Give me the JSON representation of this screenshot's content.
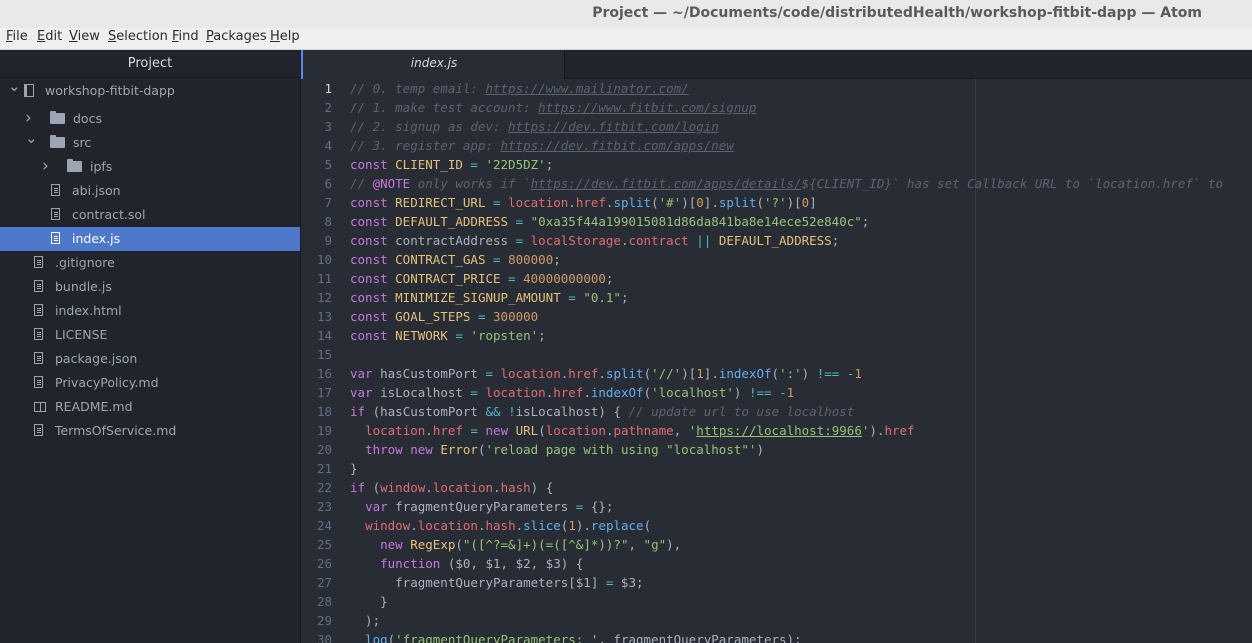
{
  "window": {
    "title": "Project — ~/Documents/code/distributedHealth/workshop-fitbit-dapp — Atom"
  },
  "menu": [
    {
      "label": "File",
      "u": "F",
      "rest": "ile"
    },
    {
      "label": "Edit",
      "u": "E",
      "rest": "dit"
    },
    {
      "label": "View",
      "u": "V",
      "rest": "iew"
    },
    {
      "label": "Selection",
      "u": "S",
      "rest": "election"
    },
    {
      "label": "Find",
      "u": "F",
      "rest": "ind"
    },
    {
      "label": "Packages",
      "u": "P",
      "rest": "ackages"
    },
    {
      "label": "Help",
      "u": "H",
      "rest": "elp"
    }
  ],
  "sidebar": {
    "header": "Project",
    "tree": [
      {
        "label": "workshop-fitbit-dapp",
        "kind": "repo",
        "depth": 0,
        "chevron": "down",
        "selected": false
      },
      {
        "label": "docs",
        "kind": "folder",
        "depth": 1,
        "chevron": "right",
        "selected": false
      },
      {
        "label": "src",
        "kind": "folder",
        "depth": 1,
        "chevron": "down",
        "selected": false
      },
      {
        "label": "ipfs",
        "kind": "folder",
        "depth": 2,
        "chevron": "right",
        "selected": false
      },
      {
        "label": "abi.json",
        "kind": "file",
        "depth": 2,
        "chevron": "",
        "selected": false
      },
      {
        "label": "contract.sol",
        "kind": "file",
        "depth": 2,
        "chevron": "",
        "selected": false
      },
      {
        "label": "index.js",
        "kind": "file",
        "depth": 2,
        "chevron": "",
        "selected": true
      },
      {
        "label": ".gitignore",
        "kind": "file",
        "depth": 1,
        "chevron": "",
        "selected": false
      },
      {
        "label": "bundle.js",
        "kind": "file",
        "depth": 1,
        "chevron": "",
        "selected": false
      },
      {
        "label": "index.html",
        "kind": "file",
        "depth": 1,
        "chevron": "",
        "selected": false
      },
      {
        "label": "LICENSE",
        "kind": "file",
        "depth": 1,
        "chevron": "",
        "selected": false
      },
      {
        "label": "package.json",
        "kind": "file",
        "depth": 1,
        "chevron": "",
        "selected": false
      },
      {
        "label": "PrivacyPolicy.md",
        "kind": "file",
        "depth": 1,
        "chevron": "",
        "selected": false
      },
      {
        "label": "README.md",
        "kind": "book",
        "depth": 1,
        "chevron": "",
        "selected": false
      },
      {
        "label": "TermsOfService.md",
        "kind": "file",
        "depth": 1,
        "chevron": "",
        "selected": false
      }
    ]
  },
  "tab": {
    "title": "index.js"
  },
  "editor": {
    "current_line": 1,
    "lines": [
      [
        [
          "c",
          "// 0. temp email: "
        ],
        [
          "cu",
          "https://www.mailinator.com/"
        ]
      ],
      [
        [
          "c",
          "// 1. make test account: "
        ],
        [
          "cu",
          "https://www.fitbit.com/signup"
        ]
      ],
      [
        [
          "c",
          "// 2. signup as dev: "
        ],
        [
          "cu",
          "https://dev.fitbit.com/login"
        ]
      ],
      [
        [
          "c",
          "// 3. register app: "
        ],
        [
          "cu",
          "https://dev.fitbit.com/apps/new"
        ]
      ],
      [
        [
          "k",
          "const "
        ],
        [
          "y",
          "CLIENT_ID"
        ],
        [
          "p",
          " "
        ],
        [
          "o",
          "="
        ],
        [
          "p",
          " "
        ],
        [
          "s",
          "'22D5DZ'"
        ],
        [
          "p",
          ";"
        ]
      ],
      [
        [
          "c",
          "// "
        ],
        [
          "k",
          "@NOTE"
        ],
        [
          "c",
          " only works if `"
        ],
        [
          "cu",
          "https://dev.fitbit.com/apps/details/"
        ],
        [
          "c",
          "${CLIENT_ID}` has set Callback URL to `location.href` to"
        ]
      ],
      [
        [
          "k",
          "const "
        ],
        [
          "y",
          "REDIRECT_URL"
        ],
        [
          "p",
          " "
        ],
        [
          "o",
          "="
        ],
        [
          "p",
          " "
        ],
        [
          "v",
          "location"
        ],
        [
          "p",
          "."
        ],
        [
          "v",
          "href"
        ],
        [
          "p",
          "."
        ],
        [
          "f",
          "split"
        ],
        [
          "p",
          "("
        ],
        [
          "s",
          "'#'"
        ],
        [
          "p",
          ")["
        ],
        [
          "n",
          "0"
        ],
        [
          "p",
          "]."
        ],
        [
          "f",
          "split"
        ],
        [
          "p",
          "("
        ],
        [
          "s",
          "'?'"
        ],
        [
          "p",
          ")["
        ],
        [
          "n",
          "0"
        ],
        [
          "p",
          "]"
        ]
      ],
      [
        [
          "k",
          "const "
        ],
        [
          "y",
          "DEFAULT_ADDRESS"
        ],
        [
          "p",
          " "
        ],
        [
          "o",
          "="
        ],
        [
          "p",
          " "
        ],
        [
          "s",
          "\"0xa35f44a199015081d86da841ba8e14ece52e840c\""
        ],
        [
          "p",
          ";"
        ]
      ],
      [
        [
          "k",
          "const "
        ],
        [
          "p",
          "contractAddress "
        ],
        [
          "o",
          "="
        ],
        [
          "p",
          " "
        ],
        [
          "v",
          "localStorage"
        ],
        [
          "p",
          "."
        ],
        [
          "v",
          "contract"
        ],
        [
          "p",
          " "
        ],
        [
          "o",
          "||"
        ],
        [
          "p",
          " "
        ],
        [
          "y",
          "DEFAULT_ADDRESS"
        ],
        [
          "p",
          ";"
        ]
      ],
      [
        [
          "k",
          "const "
        ],
        [
          "y",
          "CONTRACT_GAS"
        ],
        [
          "p",
          " "
        ],
        [
          "o",
          "="
        ],
        [
          "p",
          " "
        ],
        [
          "n",
          "800000"
        ],
        [
          "p",
          ";"
        ]
      ],
      [
        [
          "k",
          "const "
        ],
        [
          "y",
          "CONTRACT_PRICE"
        ],
        [
          "p",
          " "
        ],
        [
          "o",
          "="
        ],
        [
          "p",
          " "
        ],
        [
          "n",
          "40000000000"
        ],
        [
          "p",
          ";"
        ]
      ],
      [
        [
          "k",
          "const "
        ],
        [
          "y",
          "MINIMIZE_SIGNUP_AMOUNT"
        ],
        [
          "p",
          " "
        ],
        [
          "o",
          "="
        ],
        [
          "p",
          " "
        ],
        [
          "s",
          "\"0.1\""
        ],
        [
          "p",
          ";"
        ]
      ],
      [
        [
          "k",
          "const "
        ],
        [
          "y",
          "GOAL_STEPS"
        ],
        [
          "p",
          " "
        ],
        [
          "o",
          "="
        ],
        [
          "p",
          " "
        ],
        [
          "n",
          "300000"
        ]
      ],
      [
        [
          "k",
          "const "
        ],
        [
          "y",
          "NETWORK"
        ],
        [
          "p",
          " "
        ],
        [
          "o",
          "="
        ],
        [
          "p",
          " "
        ],
        [
          "s",
          "'ropsten'"
        ],
        [
          "p",
          ";"
        ]
      ],
      [],
      [
        [
          "k",
          "var "
        ],
        [
          "p",
          "hasCustomPort "
        ],
        [
          "o",
          "="
        ],
        [
          "p",
          " "
        ],
        [
          "v",
          "location"
        ],
        [
          "p",
          "."
        ],
        [
          "v",
          "href"
        ],
        [
          "p",
          "."
        ],
        [
          "f",
          "split"
        ],
        [
          "p",
          "("
        ],
        [
          "s",
          "'//'"
        ],
        [
          "p",
          ")["
        ],
        [
          "n",
          "1"
        ],
        [
          "p",
          "]."
        ],
        [
          "f",
          "indexOf"
        ],
        [
          "p",
          "("
        ],
        [
          "s",
          "':'"
        ],
        [
          "p",
          ") "
        ],
        [
          "o",
          "!=="
        ],
        [
          "p",
          " "
        ],
        [
          "o",
          "-"
        ],
        [
          "n",
          "1"
        ]
      ],
      [
        [
          "k",
          "var "
        ],
        [
          "p",
          "isLocalhost "
        ],
        [
          "o",
          "="
        ],
        [
          "p",
          " "
        ],
        [
          "v",
          "location"
        ],
        [
          "p",
          "."
        ],
        [
          "v",
          "href"
        ],
        [
          "p",
          "."
        ],
        [
          "f",
          "indexOf"
        ],
        [
          "p",
          "("
        ],
        [
          "s",
          "'localhost'"
        ],
        [
          "p",
          ") "
        ],
        [
          "o",
          "!=="
        ],
        [
          "p",
          " "
        ],
        [
          "o",
          "-"
        ],
        [
          "n",
          "1"
        ]
      ],
      [
        [
          "k",
          "if"
        ],
        [
          "p",
          " (hasCustomPort "
        ],
        [
          "o",
          "&&"
        ],
        [
          "p",
          " "
        ],
        [
          "o",
          "!"
        ],
        [
          "p",
          "isLocalhost) { "
        ],
        [
          "c",
          "// update url to use localhost"
        ]
      ],
      [
        [
          "p",
          "  "
        ],
        [
          "v",
          "location"
        ],
        [
          "p",
          "."
        ],
        [
          "v",
          "href"
        ],
        [
          "p",
          " "
        ],
        [
          "o",
          "="
        ],
        [
          "p",
          " "
        ],
        [
          "k",
          "new "
        ],
        [
          "y",
          "URL"
        ],
        [
          "p",
          "("
        ],
        [
          "v",
          "location"
        ],
        [
          "p",
          "."
        ],
        [
          "v",
          "pathname"
        ],
        [
          "p",
          ", "
        ],
        [
          "s",
          "'"
        ],
        [
          "su",
          "https://localhost:9966"
        ],
        [
          "s",
          "'"
        ],
        [
          "p",
          ")."
        ],
        [
          "v",
          "href"
        ]
      ],
      [
        [
          "p",
          "  "
        ],
        [
          "k",
          "throw new "
        ],
        [
          "y",
          "Error"
        ],
        [
          "p",
          "("
        ],
        [
          "s",
          "'reload page with using \"localhost\"'"
        ],
        [
          "p",
          ")"
        ]
      ],
      [
        [
          "p",
          "}"
        ]
      ],
      [
        [
          "k",
          "if"
        ],
        [
          "p",
          " ("
        ],
        [
          "v",
          "window"
        ],
        [
          "p",
          "."
        ],
        [
          "v",
          "location"
        ],
        [
          "p",
          "."
        ],
        [
          "v",
          "hash"
        ],
        [
          "p",
          ") {"
        ]
      ],
      [
        [
          "p",
          "  "
        ],
        [
          "k",
          "var "
        ],
        [
          "p",
          "fragmentQueryParameters "
        ],
        [
          "o",
          "="
        ],
        [
          "p",
          " {};"
        ]
      ],
      [
        [
          "p",
          "  "
        ],
        [
          "v",
          "window"
        ],
        [
          "p",
          "."
        ],
        [
          "v",
          "location"
        ],
        [
          "p",
          "."
        ],
        [
          "v",
          "hash"
        ],
        [
          "p",
          "."
        ],
        [
          "f",
          "slice"
        ],
        [
          "p",
          "("
        ],
        [
          "n",
          "1"
        ],
        [
          "p",
          ")."
        ],
        [
          "f",
          "replace"
        ],
        [
          "p",
          "("
        ]
      ],
      [
        [
          "p",
          "    "
        ],
        [
          "k",
          "new "
        ],
        [
          "y",
          "RegExp"
        ],
        [
          "p",
          "("
        ],
        [
          "s",
          "\"([^?=&]+)(=([^&]*))?\""
        ],
        [
          "p",
          ", "
        ],
        [
          "s",
          "\"g\""
        ],
        [
          "p",
          "),"
        ]
      ],
      [
        [
          "p",
          "    "
        ],
        [
          "k",
          "function "
        ],
        [
          "p",
          "($0, $1, $2, $3) {"
        ]
      ],
      [
        [
          "p",
          "      fragmentQueryParameters[$1] "
        ],
        [
          "o",
          "="
        ],
        [
          "p",
          " $3;"
        ]
      ],
      [
        [
          "p",
          "    }"
        ]
      ],
      [
        [
          "p",
          "  );"
        ]
      ],
      [
        [
          "p",
          "  "
        ],
        [
          "f",
          "log"
        ],
        [
          "p",
          "("
        ],
        [
          "s",
          "'fragmentQueryParameters: '"
        ],
        [
          "p",
          ", fragmentQueryParameters);"
        ]
      ]
    ]
  }
}
